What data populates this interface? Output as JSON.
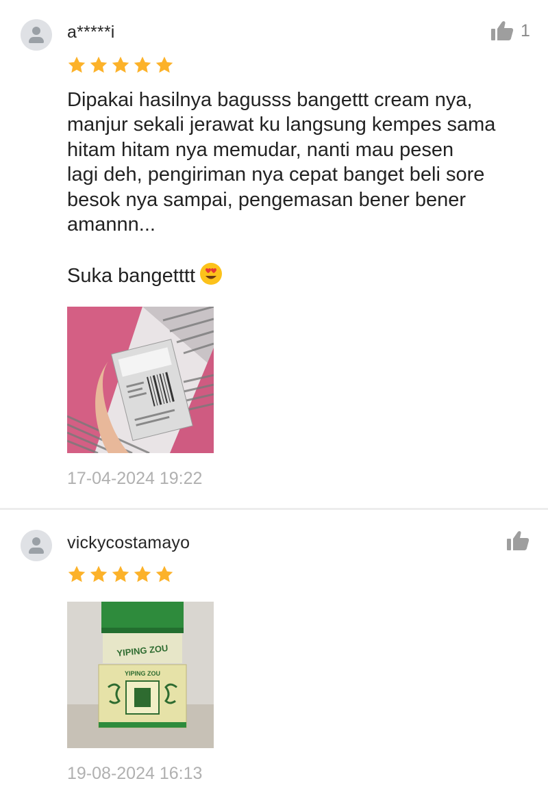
{
  "reviews": [
    {
      "username": "a*****i",
      "like_count": "1",
      "rating": 5,
      "text": "Dipakai hasilnya bagusss bangettt cream nya,\nmanjur sekali jerawat ku langsung kempes sama\nhitam hitam nya memudar, nanti mau pesen\nlagi deh, pengiriman nya cepat banget beli sore\nbesok nya sampai, pengemasan bener bener\namannn...\n\nSuka bangetttt",
      "emoji": "heart-eyes-emoji",
      "timestamp": "17-04-2024 19:22"
    },
    {
      "username": "vickycostamayo",
      "rating": 5,
      "photo_label_top": "YIPING ZOU",
      "photo_label_box": "YIPING ZOU",
      "timestamp": "19-08-2024 16:13"
    }
  ],
  "icons": {
    "avatar": "user-avatar-icon",
    "like": "thumbs-up-icon",
    "star": "star-icon"
  },
  "colors": {
    "star": "#fcb22a",
    "like_icon": "#9e9e9e",
    "timestamp": "#b0b0b0",
    "divider": "#ececec",
    "avatar_bg": "#dfe1e5"
  }
}
